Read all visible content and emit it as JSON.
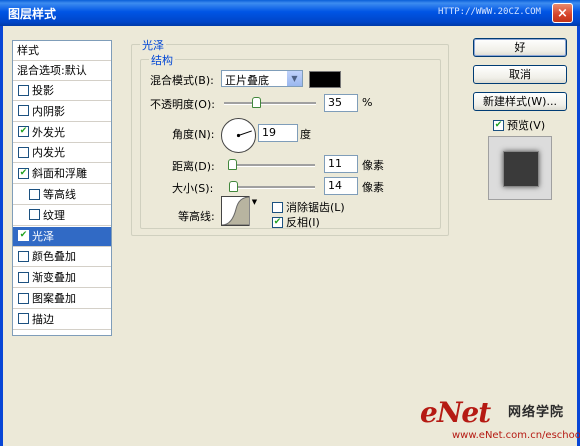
{
  "window": {
    "title": "图层样式",
    "watermark_top": "HTTP://WWW.20CZ.COM",
    "close_symbol": "×"
  },
  "style_list": {
    "header": "样式",
    "blend_options": "混合选项:默认",
    "items": [
      {
        "label": "投影",
        "checked": false,
        "selected": false,
        "indent": false
      },
      {
        "label": "内阴影",
        "checked": false,
        "selected": false,
        "indent": false
      },
      {
        "label": "外发光",
        "checked": true,
        "selected": false,
        "indent": false
      },
      {
        "label": "内发光",
        "checked": false,
        "selected": false,
        "indent": false
      },
      {
        "label": "斜面和浮雕",
        "checked": true,
        "selected": false,
        "indent": false
      },
      {
        "label": "等高线",
        "checked": false,
        "selected": false,
        "indent": true
      },
      {
        "label": "纹理",
        "checked": false,
        "selected": false,
        "indent": true
      },
      {
        "label": "光泽",
        "checked": true,
        "selected": true,
        "indent": false
      },
      {
        "label": "颜色叠加",
        "checked": false,
        "selected": false,
        "indent": false
      },
      {
        "label": "渐变叠加",
        "checked": false,
        "selected": false,
        "indent": false
      },
      {
        "label": "图案叠加",
        "checked": false,
        "selected": false,
        "indent": false
      },
      {
        "label": "描边",
        "checked": false,
        "selected": false,
        "indent": false
      }
    ]
  },
  "satin": {
    "group_title": "光泽",
    "structure_title": "结构",
    "blend_mode_label": "混合模式(B):",
    "blend_mode_value": "正片叠底",
    "blend_color": "#000000",
    "opacity_label": "不透明度(O):",
    "opacity_value": "35",
    "opacity_unit": "%",
    "opacity_slider": 0.35,
    "angle_label": "角度(N):",
    "angle_value": "19",
    "angle_unit": "度",
    "distance_label": "距离(D):",
    "distance_value": "11",
    "distance_unit": "像素",
    "distance_slider": 0.04,
    "size_label": "大小(S):",
    "size_value": "14",
    "size_unit": "像素",
    "size_slider": 0.05,
    "contour_label": "等高线:",
    "antialias_label": "消除锯齿(L)",
    "antialias_checked": false,
    "invert_label": "反相(I)",
    "invert_checked": true
  },
  "buttons": {
    "ok": "好",
    "cancel": "取消",
    "new_style": "新建样式(W)..."
  },
  "preview": {
    "label": "预览(V)",
    "checked": true
  },
  "watermark": {
    "brand": "eNet",
    "brand_cn": "网络学院",
    "url": "www.eNet.com.cn/eschool"
  },
  "colors": {
    "title_bar": "#0055e5",
    "selected": "#316ac5",
    "group_title": "#0046d5",
    "brand": "#b51a13"
  }
}
